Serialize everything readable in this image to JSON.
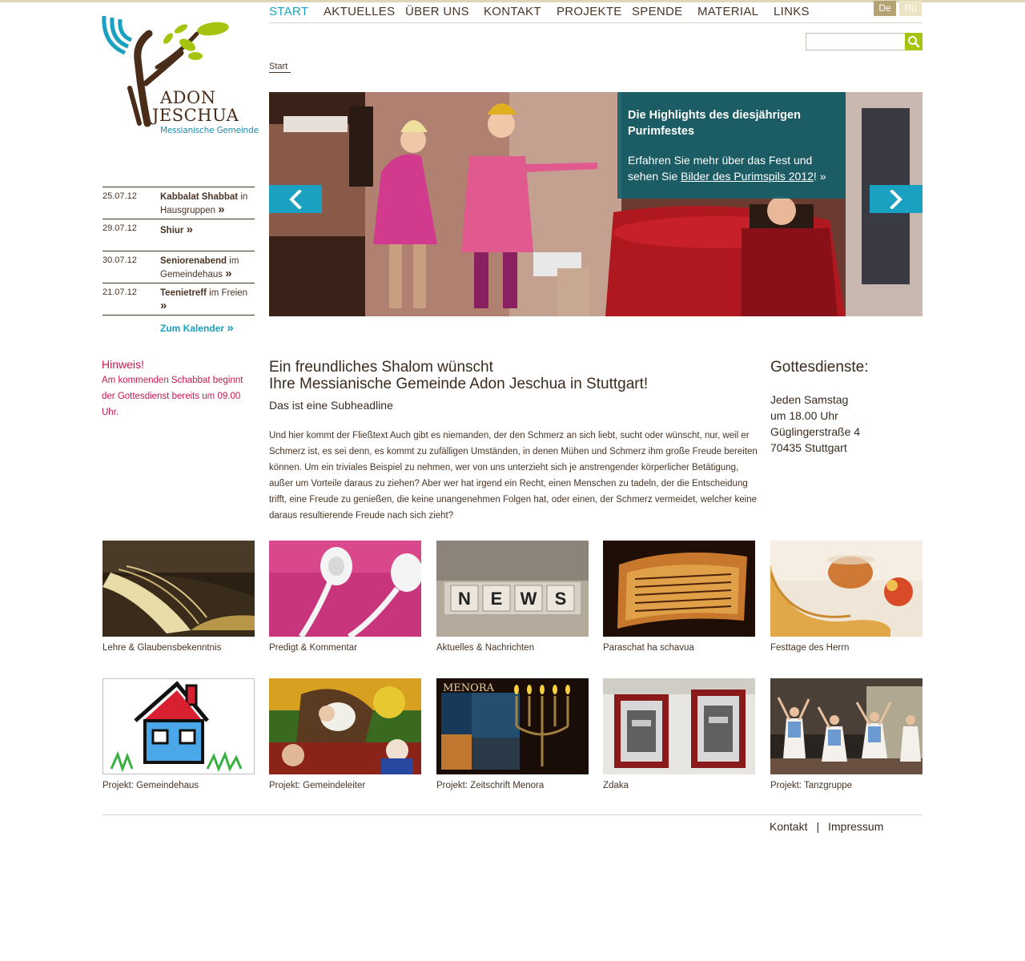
{
  "colors": {
    "accent": "#1aa0c0",
    "brown": "#4a3424",
    "green": "#a6c30f",
    "notice": "#c8194f",
    "caption_bg": "#14606a"
  },
  "logo": {
    "line1": "ADON",
    "line2": "JESCHUA",
    "subtitle": "Messianische Gemeinde"
  },
  "nav": {
    "items": [
      {
        "label": "START",
        "active": true
      },
      {
        "label": "AKTUELLES"
      },
      {
        "label": "ÜBER UNS"
      },
      {
        "label": "KONTAKT"
      },
      {
        "label": "PROJEKTE"
      },
      {
        "label": "SPENDE"
      },
      {
        "label": "MATERIAL"
      },
      {
        "label": "LINKS"
      }
    ]
  },
  "languages": [
    {
      "label": "De",
      "active": true
    },
    {
      "label": "Ru"
    }
  ],
  "search": {
    "value": "",
    "icon": "search-icon"
  },
  "breadcrumb": "Start",
  "slider": {
    "title": "Die Highlights des diesjährigen Purimfestes",
    "text_before": "Erfahren Sie mehr über das Fest und sehen Sie ",
    "link": "Bilder des Purimspils 2012",
    "text_after": "! »",
    "prev_icon": "chevron-left-icon",
    "next_icon": "chevron-right-icon"
  },
  "events": [
    {
      "date": "25.07.12",
      "title": "Kabbalat Shabbat",
      "rest": " in Hausgruppen"
    },
    {
      "date": "29.07.12",
      "title": "Shiur",
      "rest": ""
    },
    {
      "date": "30.07.12",
      "title": "Seniorenabend",
      "rest": " im Gemeindehaus"
    },
    {
      "date": "21.07.12",
      "title": "Teenietreff",
      "rest": " im Freien"
    }
  ],
  "calendar_link": "Zum Kalender",
  "notice": {
    "title": "Hinweis!",
    "text": "Am kommenden Schabbat beginnt der Gottesdienst bereits um 09.00 Uhr."
  },
  "main": {
    "headline1": "Ein freundliches Shalom wünscht",
    "headline2": "Ihre Messianische Gemeinde Adon Jeschua in Stuttgart!",
    "subheadline": "Das ist eine Subheadline",
    "body": "Und hier kommt der Fließtext Auch gibt es niemanden, der den Schmerz an sich liebt, sucht oder wünscht, nur, weil er Schmerz ist, es sei denn, es kommt zu zufälligen Umständen, in denen Mühen und Schmerz ihm große Freude bereiten können. Um ein triviales Beispiel zu nehmen, wer von uns unterzieht sich je anstrengender körperlicher Betätigung, außer um Vorteile daraus zu ziehen? Aber wer hat irgend ein Recht, einen Menschen zu tadeln, der die Entscheidung trifft, eine Freude zu genießen, die keine unangenehmen Folgen hat, oder einen, der Schmerz vermeidet, welcher keine daraus resultierende Freude nach sich zieht?"
  },
  "services": {
    "title": "Gottesdienste:",
    "lines": [
      "Jeden Samstag",
      "um 18.00 Uhr",
      "Güglingerstraße 4",
      "70435 Stuttgart"
    ]
  },
  "tiles": [
    {
      "label": "Lehre & Glaubensbekenntnis"
    },
    {
      "label": "Predigt & Kommentar"
    },
    {
      "label": "Aktuelles & Nachrichten"
    },
    {
      "label": "Paraschat ha schavua"
    },
    {
      "label": "Festtage des Herrn"
    },
    {
      "label": "Projekt: Gemeindehaus"
    },
    {
      "label": "Projekt: Gemeindeleiter"
    },
    {
      "label": "Projekt: Zeitschrift Menora"
    },
    {
      "label": "Zdaka"
    },
    {
      "label": "Projekt: Tanzgruppe"
    }
  ],
  "news_word": "NEWS",
  "menora_word": "MENORA",
  "footer": {
    "link1": "Kontakt",
    "separator": "|",
    "link2": "Impressum"
  }
}
